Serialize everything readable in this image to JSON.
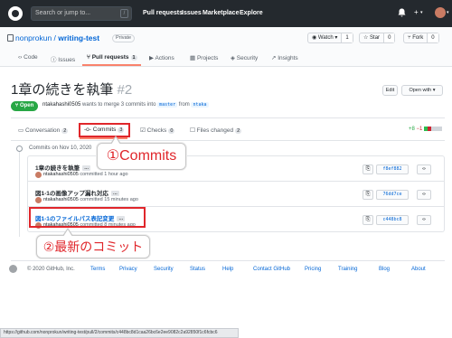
{
  "header": {
    "search_placeholder": "Search or jump to...",
    "search_shortcut": "/",
    "nav": [
      "Pull requests",
      "Issues",
      "Marketplace",
      "Explore"
    ],
    "bell_icon": "bell-icon",
    "plus_label": "+",
    "caret": "▾"
  },
  "repo": {
    "owner": "nonprokun",
    "separator": " / ",
    "name": "writing-test",
    "visibility": "Private",
    "watch_label": "◉ Watch ▾",
    "watch_count": "1",
    "star_label": "☆ Star",
    "star_count": "0",
    "fork_label": "⑂ Fork",
    "fork_count": "0"
  },
  "repo_tabs": {
    "code": "‹› Code",
    "issues": "ⓘ Issues",
    "pull_requests": "⑂ Pull requests",
    "pull_requests_count": "1",
    "actions": "▶ Actions",
    "projects": "▦ Projects",
    "security": "◈ Security",
    "insights": "↗ Insights"
  },
  "pr": {
    "title": "1章の続きを執筆",
    "number": "#2",
    "edit_label": "Edit",
    "open_with_label": "Open with ▾",
    "state": "⑂ Open",
    "author": "ntakahashi0505",
    "meta_middle": " wants to merge 3 commits into ",
    "base_branch": "master",
    "meta_from": " from ",
    "head_branch": "ntaka"
  },
  "pr_tabs": {
    "conversation": "▭ Conversation",
    "conversation_count": "2",
    "commits": "-o- Commits",
    "commits_count": "3",
    "checks": "☑ Checks",
    "checks_count": "0",
    "files": "☐ Files changed",
    "files_count": "2",
    "additions": "+8",
    "deletions": "−1"
  },
  "commits": {
    "group_label": "Commits on Nov 10, 2020",
    "items": [
      {
        "title": "1章の続きを執筆",
        "author": "ntakahashi0505",
        "time": " committed 1 hour ago",
        "sha": "f8ef882",
        "link": false
      },
      {
        "title": "図1-1の画像アップ漏れ対応",
        "author": "ntakahashi0505",
        "time": " committed 15 minutes ago",
        "sha": "76dd7ce",
        "link": false
      },
      {
        "title": "図1-1のファイルパス表記変更",
        "author": "ntakahashi0505",
        "time": " committed 8 minutes ago",
        "sha": "c448bc8",
        "link": true
      }
    ],
    "ellipsis": "…",
    "copy_icon": "clipboard-icon",
    "browse_label": "‹›"
  },
  "annotations": {
    "callout1": "①Commits",
    "callout2": "②最新のコミット",
    "highlight_color": "#e0262b"
  },
  "footer": {
    "copyright": "© 2020 GitHub, Inc.",
    "links": [
      "Terms",
      "Privacy",
      "Security",
      "Status",
      "Help",
      "Contact GitHub",
      "Pricing",
      "Training",
      "Blog",
      "About"
    ]
  },
  "statusbar": {
    "url": "https://github.com/nonprokun/writing-test/pull/2/commits/c448bc8d1caa26bc6e2ee9082c2a92850f1c6fcbc6"
  }
}
